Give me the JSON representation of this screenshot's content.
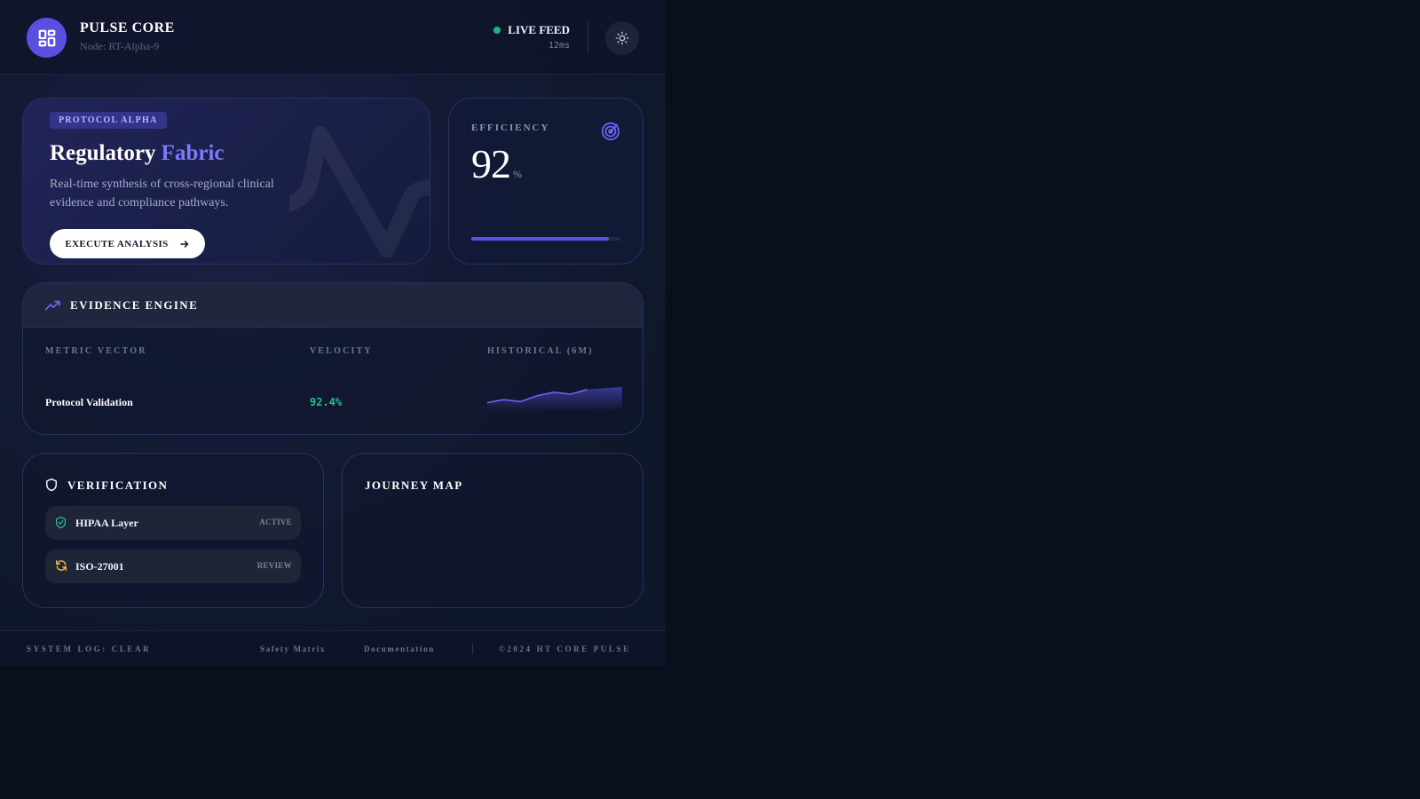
{
  "header": {
    "brand_title": "PULSE CORE",
    "brand_subtitle": "Node: RT-Alpha-9",
    "live_label": "LIVE FEED",
    "latency": "12ms"
  },
  "hero": {
    "badge": "PROTOCOL ALPHA",
    "title_main": "Regulatory",
    "title_accent": "Fabric",
    "description": "Real-time synthesis of cross-regional clinical evidence and compliance pathways.",
    "cta_label": "EXECUTE ANALYSIS"
  },
  "efficiency": {
    "label": "EFFICIENCY",
    "value": "92",
    "unit": "%",
    "progress": 0.92
  },
  "evidence_engine": {
    "title": "EVIDENCE ENGINE",
    "columns": [
      "METRIC VECTOR",
      "VELOCITY",
      "HISTORICAL (6M)"
    ],
    "rows": [
      {
        "metric": "Protocol Validation",
        "velocity": "92.4%",
        "history": [
          0.25,
          0.4,
          0.3,
          0.6,
          0.78,
          0.68,
          0.92
        ]
      }
    ]
  },
  "verification": {
    "title": "VERIFICATION",
    "items": [
      {
        "name": "HIPAA Layer",
        "status": "ACTIVE",
        "icon": "shield-check-icon"
      },
      {
        "name": "ISO-27001",
        "status": "REVIEW",
        "icon": "refresh-icon"
      }
    ]
  },
  "journey": {
    "title": "JOURNEY MAP"
  },
  "footer": {
    "log": "SYSTEM LOG: CLEAR",
    "links": [
      "Safety Matrix",
      "Documentation"
    ],
    "copyright": "©2024 HT CORE PULSE"
  },
  "colors": {
    "accent": "#5b54e6",
    "success": "#22c08a",
    "warning": "#f5b73c"
  }
}
